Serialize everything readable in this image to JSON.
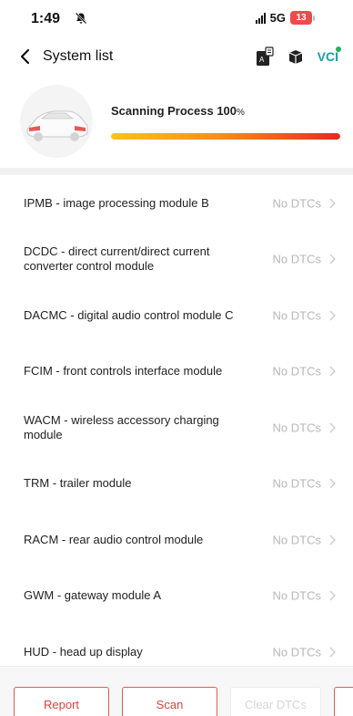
{
  "status_bar": {
    "time": "1:49",
    "network": "5G",
    "battery": "13"
  },
  "nav": {
    "title": "System list",
    "vci_label": "VCI"
  },
  "scan": {
    "label": "Scanning Process 100",
    "percent_sign": "%",
    "progress": 1.0
  },
  "modules": [
    {
      "name": "IPMB - image processing module B",
      "status": "No DTCs"
    },
    {
      "name": "DCDC - direct current/direct current converter control module",
      "status": "No DTCs"
    },
    {
      "name": "DACMC - digital audio control module C",
      "status": "No DTCs"
    },
    {
      "name": "FCIM - front controls interface module",
      "status": "No DTCs"
    },
    {
      "name": "WACM - wireless accessory charging module",
      "status": "No DTCs"
    },
    {
      "name": "TRM - trailer module",
      "status": "No DTCs"
    },
    {
      "name": "RACM - rear audio control module",
      "status": "No DTCs"
    },
    {
      "name": "GWM - gateway module A",
      "status": "No DTCs"
    },
    {
      "name": "HUD - head up display",
      "status": "No DTCs"
    }
  ],
  "buttons": {
    "report": "Report",
    "scan": "Scan",
    "clear_dtcs": "Clear DTCs"
  },
  "colors": {
    "accent": "#e0433a",
    "vci": "#1aa0a8",
    "progress_start": "#ffc21a",
    "progress_end": "#e52b1e"
  }
}
